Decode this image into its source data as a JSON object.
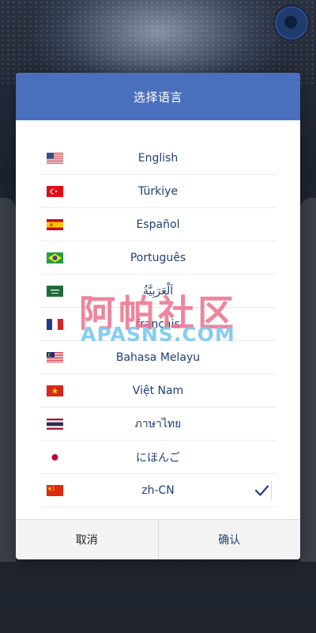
{
  "dialog": {
    "title": "选择语言",
    "cancel_label": "取消",
    "confirm_label": "确认"
  },
  "languages": [
    {
      "label": "English",
      "flag": "us-flag-icon"
    },
    {
      "label": "Türkiye",
      "flag": "tr-flag-icon"
    },
    {
      "label": "Español",
      "flag": "es-flag-icon"
    },
    {
      "label": "Português",
      "flag": "br-flag-icon"
    },
    {
      "label": "اَلْعَرَبِيَّةُ",
      "flag": "sa-flag-icon"
    },
    {
      "label": "français",
      "flag": "fr-flag-icon"
    },
    {
      "label": "Bahasa Melayu",
      "flag": "my-flag-icon"
    },
    {
      "label": "Việt Nam",
      "flag": "vn-flag-icon"
    },
    {
      "label": "ภาษาไทย",
      "flag": "th-flag-icon"
    },
    {
      "label": "にほんご",
      "flag": "jp-flag-icon"
    },
    {
      "label": "zh-CN",
      "flag": "cn-flag-icon",
      "selected": true
    }
  ],
  "watermark": {
    "cn": "阿帕社区",
    "en": "APASNS.COM"
  },
  "colors": {
    "header": "#4a70bd",
    "text": "#1f3f74"
  }
}
